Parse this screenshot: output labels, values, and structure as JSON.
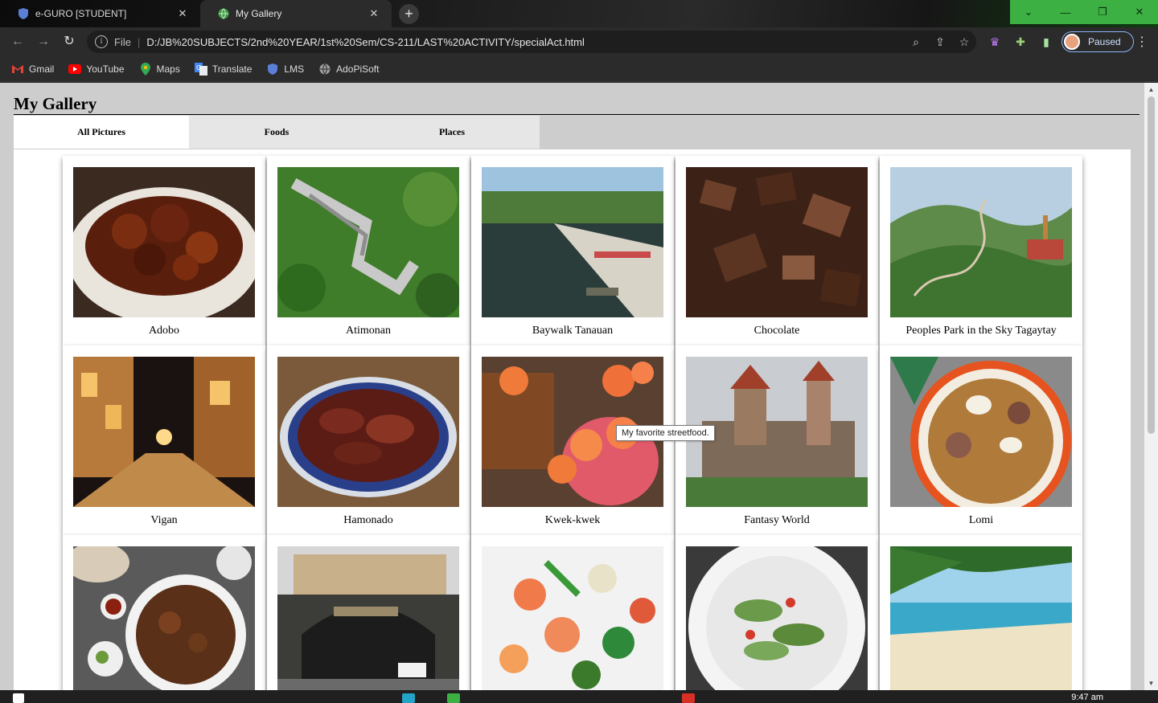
{
  "browser": {
    "tabs": [
      {
        "title": "e-GURO [STUDENT]",
        "active": false
      },
      {
        "title": "My Gallery",
        "active": true
      }
    ],
    "url_scheme": "File",
    "url": "D:/JB%20SUBJECTS/2nd%20YEAR/1st%20Sem/CS-211/LAST%20ACTIVITY/specialAct.html",
    "profile_status": "Paused",
    "bookmarks": [
      {
        "label": "Gmail",
        "icon": "gmail-icon"
      },
      {
        "label": "YouTube",
        "icon": "youtube-icon"
      },
      {
        "label": "Maps",
        "icon": "maps-icon"
      },
      {
        "label": "Translate",
        "icon": "translate-icon"
      },
      {
        "label": "LMS",
        "icon": "shield-icon"
      },
      {
        "label": "AdoPiSoft",
        "icon": "globe-icon"
      }
    ],
    "accent": "#3cb043"
  },
  "page": {
    "title": "My Gallery",
    "tabs": [
      {
        "label": "All Pictures",
        "active": true
      },
      {
        "label": "Foods",
        "active": false
      },
      {
        "label": "Places",
        "active": false
      }
    ],
    "gallery": [
      {
        "caption": "Adobo",
        "kind": "food"
      },
      {
        "caption": "Atimonan",
        "kind": "place"
      },
      {
        "caption": "Baywalk Tanauan",
        "kind": "place"
      },
      {
        "caption": "Chocolate",
        "kind": "food"
      },
      {
        "caption": "Peoples Park in the Sky Tagaytay",
        "kind": "place"
      },
      {
        "caption": "Vigan",
        "kind": "place"
      },
      {
        "caption": "Hamonado",
        "kind": "food"
      },
      {
        "caption": "Kwek-kwek",
        "kind": "food"
      },
      {
        "caption": "Fantasy World",
        "kind": "place"
      },
      {
        "caption": "Lomi",
        "kind": "food"
      },
      {
        "caption": "",
        "kind": "food"
      },
      {
        "caption": "",
        "kind": "place"
      },
      {
        "caption": "",
        "kind": "food"
      },
      {
        "caption": "",
        "kind": "food"
      },
      {
        "caption": "",
        "kind": "place"
      }
    ],
    "tooltip": "My favorite streetfood."
  },
  "taskbar": {
    "clock": "9:47 am"
  }
}
